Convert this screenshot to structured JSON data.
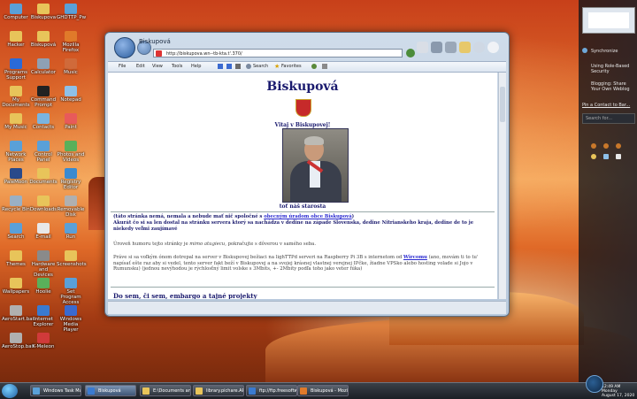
{
  "desktop": {
    "icons": [
      {
        "label": "Computer",
        "color": "#5aa0d8"
      },
      {
        "label": "Biskupova",
        "color": "#e8c45a"
      },
      {
        "label": "GHDTTP_Pw",
        "color": "#5aa0d8"
      },
      {
        "label": "Hacker",
        "color": "#e8c45a"
      },
      {
        "label": "Biskupová",
        "color": "#e8c45a"
      },
      {
        "label": "Mozilla Firefox",
        "color": "#e07a2a"
      },
      {
        "label": "Programs Support",
        "color": "#2a6ad8"
      },
      {
        "label": "Calculator",
        "color": "#8ea0b4"
      },
      {
        "label": "Music",
        "color": "#d06a3a"
      },
      {
        "label": "My Documents",
        "color": "#e8c45a"
      },
      {
        "label": "Command Prompt",
        "color": "#222222"
      },
      {
        "label": "Notepad",
        "color": "#8ec0e8"
      },
      {
        "label": "My Music",
        "color": "#e8c45a"
      },
      {
        "label": "Contacts",
        "color": "#7ab4e0"
      },
      {
        "label": "Paint",
        "color": "#e85a5a"
      },
      {
        "label": "Network Places",
        "color": "#5aa0d8"
      },
      {
        "label": "Control Panel",
        "color": "#5aa0d8"
      },
      {
        "label": "Photos and Videos",
        "color": "#5ab05a"
      },
      {
        "label": "PaleMoon",
        "color": "#2a4a8a"
      },
      {
        "label": "Documents",
        "color": "#e8c45a"
      },
      {
        "label": "Registry Editor",
        "color": "#3a8ad0"
      },
      {
        "label": "Recycle Bin",
        "color": "#9ab0c4"
      },
      {
        "label": "Downloads",
        "color": "#e8c45a"
      },
      {
        "label": "Removable Disk",
        "color": "#b0b0b0"
      },
      {
        "label": "Search",
        "color": "#5aa0d8"
      },
      {
        "label": "E-mail",
        "color": "#e8e8e8"
      },
      {
        "label": "Run",
        "color": "#5aa0d8"
      },
      {
        "label": "Themes",
        "color": "#e8c45a"
      },
      {
        "label": "Hardware and Devices",
        "color": "#8a8a8a"
      },
      {
        "label": "Screenshots",
        "color": "#e8c45a"
      },
      {
        "label": "Wallpapers",
        "color": "#e8c45a"
      },
      {
        "label": "Hoolie",
        "color": "#5ab05a"
      },
      {
        "label": "Set Program Access an...",
        "color": "#5aa0d8"
      },
      {
        "label": "AeroStart.bat",
        "color": "#b0b0b0"
      },
      {
        "label": "Internet Explorer",
        "color": "#3a7ad0"
      },
      {
        "label": "Windows Media Player",
        "color": "#3a6ad0"
      },
      {
        "label": "AeroStop.bat",
        "color": "#b0b0b0"
      },
      {
        "label": "K-Meleon",
        "color": "#d03a3a"
      }
    ]
  },
  "sidebar": {
    "synchronize": "Synchronize",
    "items": [
      "Using Role-Based Security",
      "Blogging: Share Your Own Weblog"
    ],
    "pin_link": "Pin a Contact to Bar...",
    "search_placeholder": "Search for..."
  },
  "browser": {
    "title": "Biskupová",
    "address": "http://biskupova.wn--tb-kta.t'.370/",
    "menu": [
      "File",
      "Edit",
      "View",
      "Tools",
      "Help"
    ],
    "toolbar": {
      "search": "Search",
      "favorites": "Favorites"
    },
    "page": {
      "heading": "Biskupová",
      "welcome": "Vitaj v Biskupovej!",
      "photo_caption": "toť náš starosta",
      "notice_prefix": "(táto stránka nemá, nemala a nebude mať nič spoločné s ",
      "notice_link": "obecným úradom obce Biskupová",
      "notice_suffix": ")",
      "intro_bold": "Akurát čo si sa len dostal na stránku servera ktorý sa nachádza v dedine na západe Slovenska, dedine Nitrianskeho kraja, dedine de to je niekedy veľmi zaujímavé",
      "line2_prefix": "Úroveň humoru tejto stránky je ",
      "line2_em": "mimo atugiecu",
      "line2_suffix": ", pokračujte s dôverou v samého seba.",
      "para3_a": "Práve si sa voľkým ónom dotrepal na server v Biskupovej bežiaci na lighTTPd serveri na Raspberry Pi 3B s internetom od ",
      "para3_link": "Wircomu",
      "para3_b": " (ano, movám ti to tu' napísať ešte raz aby si vedel, tento server fakt beží v Biskupovej a na svojej krásnej vlastnej verejnej IPčke, žiadne VPSko alebo hosting volade si Jojo v Rumunsku) (jednou nevýhodou je rýchlosťný limit volske s 3Mbits, +- 2Mbity podľa toho jako veter fúka)",
      "subheading": "Do sem, či sem, embargo a tajné projekty"
    }
  },
  "taskbar": {
    "tasks": [
      {
        "label": "Windows Task Ma...",
        "color": "#5aa0d8"
      },
      {
        "label": "Biskupová",
        "color": "#3a7ad0",
        "active": true
      },
      {
        "label": "E:\\Documents and ...",
        "color": "#e8c45a"
      },
      {
        "label": "library.pichare.APP...",
        "color": "#e8c45a"
      },
      {
        "label": "ftp://ftp.freesoftw...",
        "color": "#3a7ad0"
      },
      {
        "label": "Biskupová - Mozilla ...",
        "color": "#e07a2a"
      }
    ],
    "time": "12:49 AM",
    "day": "Monday",
    "date": "August 17, 2020"
  }
}
